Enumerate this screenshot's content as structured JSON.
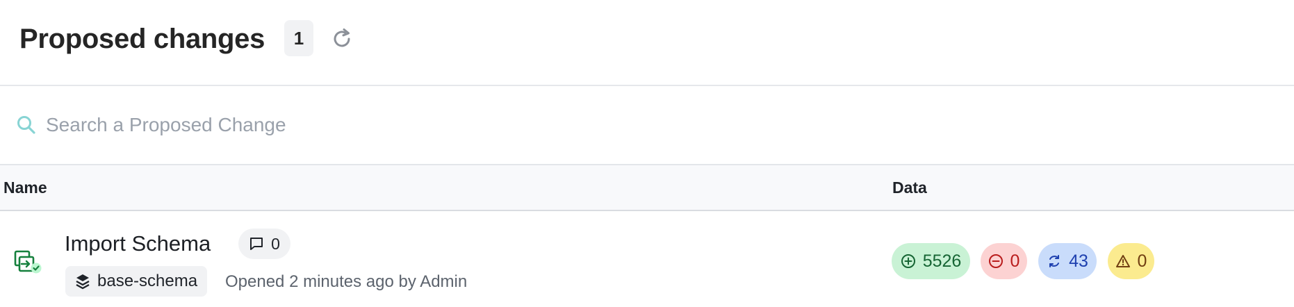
{
  "header": {
    "title": "Proposed changes",
    "count": "1",
    "refresh_icon": "refresh-icon"
  },
  "search": {
    "placeholder": "Search a Proposed Change",
    "value": "",
    "icon": "search-icon"
  },
  "table": {
    "columns": [
      "Name",
      "Data"
    ],
    "rows": [
      {
        "icon": "proposed-change-merged-icon",
        "title": "Import Schema",
        "comments": "0",
        "branch": "base-schema",
        "opened_text": "Opened 2 minutes ago by Admin",
        "stats": {
          "added": "5526",
          "removed": "0",
          "updated": "43",
          "conflicts": "0"
        }
      }
    ]
  },
  "colors": {
    "added_bg": "#c9f2d5",
    "added_fg": "#166534",
    "removed_bg": "#fcd2d2",
    "removed_fg": "#b91c1c",
    "updated_bg": "#c9dcfb",
    "updated_fg": "#1e40af",
    "conflict_bg": "#fbeb8f",
    "conflict_fg": "#713f12",
    "row_icon": "#15803d"
  }
}
